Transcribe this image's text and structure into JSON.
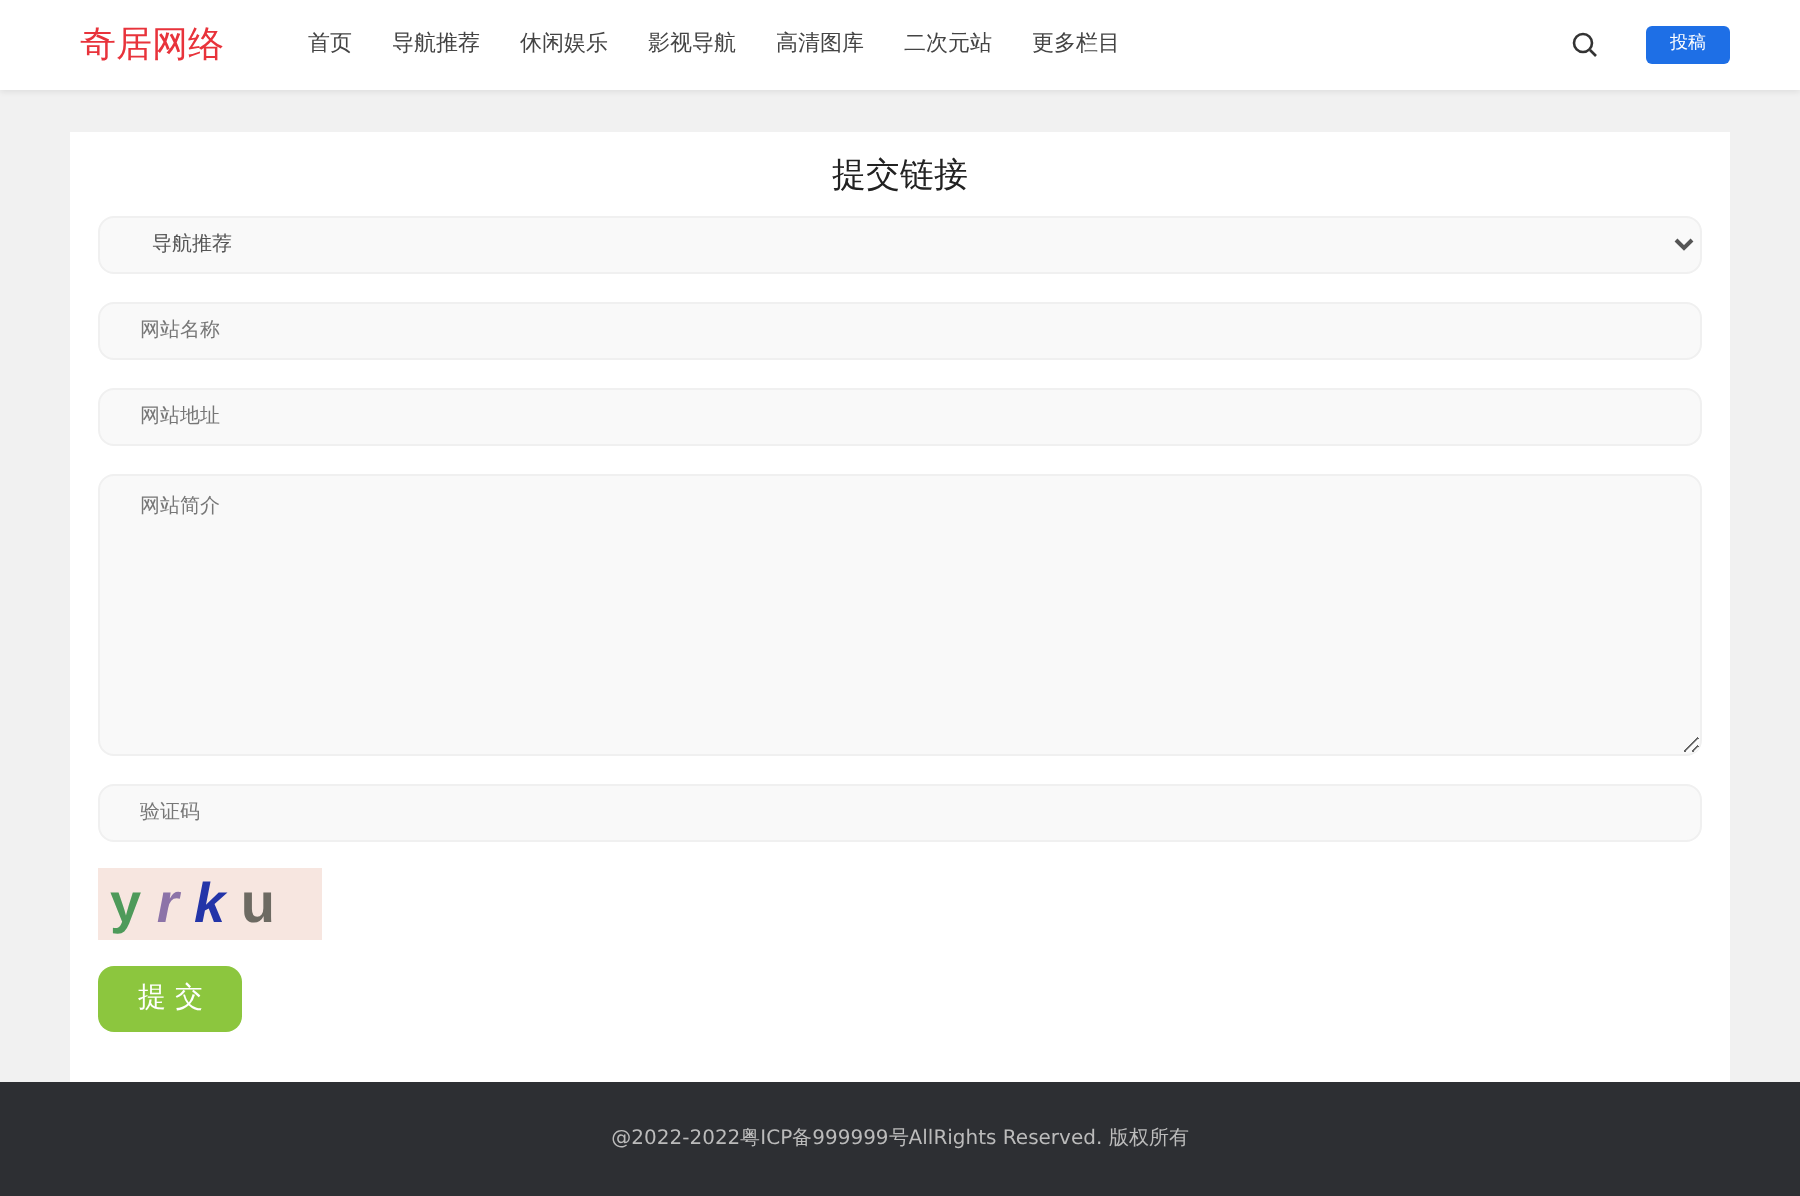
{
  "header": {
    "logo": "奇居网络",
    "nav": [
      {
        "label": "首页",
        "selected": false
      },
      {
        "label": "导航推荐",
        "selected": false
      },
      {
        "label": "休闲娱乐",
        "selected": false
      },
      {
        "label": "影视导航",
        "selected": false
      },
      {
        "label": "高清图库",
        "selected": false
      },
      {
        "label": "二次元站",
        "selected": false
      },
      {
        "label": "更多栏目",
        "selected": false
      }
    ],
    "submit_button": "投稿"
  },
  "form": {
    "title": "提交链接",
    "category": {
      "value": "导航推荐"
    },
    "fields": [
      {
        "kind": "input",
        "placeholder": "网站名称"
      },
      {
        "kind": "input",
        "placeholder": "网站地址"
      },
      {
        "kind": "textarea",
        "placeholder": "网站简介"
      },
      {
        "kind": "input",
        "placeholder": "验证码"
      }
    ],
    "captcha": "y r k u",
    "submit": "提 交"
  },
  "footer": {
    "text": "@2022-2022粤ICP备999999号AllRights Reserved. 版权所有"
  }
}
